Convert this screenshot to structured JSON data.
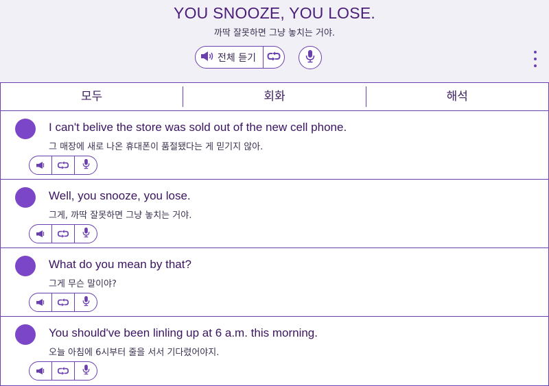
{
  "header": {
    "title": "YOU SNOOZE, YOU LOSE.",
    "subtitle": "까딱 잘못하면 그냥 놓치는 거야.",
    "play_all_label": "전체 듣기",
    "icons": [
      "speaker-icon",
      "loop-icon",
      "microphone-icon",
      "more-vertical-icon"
    ]
  },
  "tabs": [
    {
      "label": "모두"
    },
    {
      "label": "회화"
    },
    {
      "label": "해석"
    }
  ],
  "dialogue": [
    {
      "en": "I can't belive the store was sold out of the new cell phone.",
      "ko": "그 매장에 새로 나온 휴대폰이 품절됐다는 게 믿기지 않아."
    },
    {
      "en": "Well, you snooze, you lose.",
      "ko": "그게, 까딱 잘못하면 그냥 놓치는 거야."
    },
    {
      "en": "What do you mean by that?",
      "ko": "그게 무슨 말이야?"
    },
    {
      "en": "You should've been linling up at 6 a.m. this morning.",
      "ko": "오늘 아침에 6시부터 줄을 서서 기다렸어야지."
    }
  ],
  "colors": {
    "accent": "#6a3fb0",
    "avatar": "#7b47c8",
    "title": "#4a1e78",
    "background": "#f1f0f6"
  }
}
